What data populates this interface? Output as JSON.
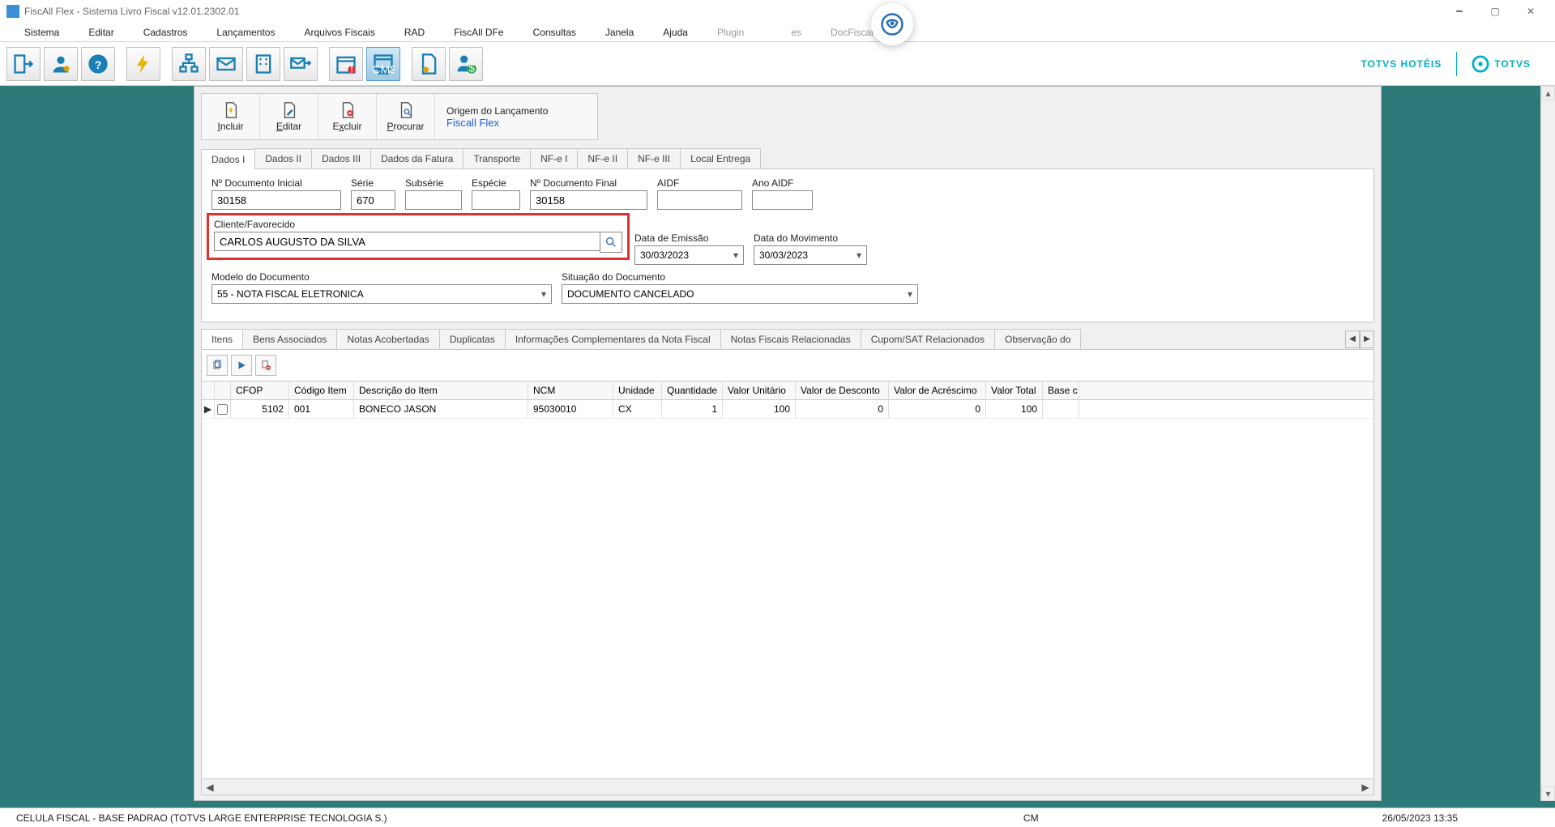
{
  "window": {
    "title": "FiscAll Flex - Sistema Livro Fiscal v12.01.2302.01"
  },
  "menubar": {
    "items": [
      "Sistema",
      "Editar",
      "Cadastros",
      "Lançamentos",
      "Arquivos Fiscais",
      "RAD",
      "FiscAll DFe",
      "Consultas",
      "Janela",
      "Ajuda"
    ],
    "disabled": [
      "Plugin",
      "",
      "es",
      "DocFiscall"
    ]
  },
  "brand": {
    "hoteis": "TOTVS HOTÉIS",
    "totvs": "TOTVS"
  },
  "actions": {
    "incluir": "Incluir",
    "editar": "Editar",
    "excluir": "Excluir",
    "procurar": "Procurar",
    "origin_label": "Origem do Lançamento",
    "origin_value": "Fiscall Flex"
  },
  "tabs_main": [
    "Dados I",
    "Dados II",
    "Dados III",
    "Dados da Fatura",
    "Transporte",
    "NF-e I",
    "NF-e II",
    "NF-e III",
    "Local Entrega"
  ],
  "form": {
    "ndoc_ini_label": "Nº Documento Inicial",
    "ndoc_ini": "30158",
    "serie_label": "Série",
    "serie": "670",
    "subserie_label": "Subsérie",
    "subserie": "",
    "especie_label": "Espécie",
    "especie": "",
    "ndoc_fin_label": "Nº Documento Final",
    "ndoc_fin": "30158",
    "aidf_label": "AIDF",
    "aidf": "",
    "ano_aidf_label": "Ano AIDF",
    "ano_aidf": "",
    "cliente_label": "Cliente/Favorecido",
    "cliente": "CARLOS AUGUSTO DA SILVA",
    "data_emissao_label": "Data de Emissão",
    "data_emissao": "30/03/2023",
    "data_mov_label": "Data do Movimento",
    "data_mov": "30/03/2023",
    "modelo_label": "Modelo do Documento",
    "modelo": "55 - NOTA FISCAL ELETRONICA",
    "situacao_label": "Situação do Documento",
    "situacao": "DOCUMENTO CANCELADO"
  },
  "tabs_items": [
    "Itens",
    "Bens Associados",
    "Notas Acobertadas",
    "Duplicatas",
    "Informações Complementares da Nota Fiscal",
    "Notas Fiscais Relacionadas",
    "Cupom/SAT Relacionados",
    "Observação do"
  ],
  "grid": {
    "headers": [
      "CFOP",
      "Código Item",
      "Descrição do Item",
      "NCM",
      "Unidade",
      "Quantidade",
      "Valor Unitário",
      "Valor de Desconto",
      "Valor de Acréscimo",
      "Valor Total",
      "Base c"
    ],
    "row": {
      "cfop": "5102",
      "codigo": "001",
      "desc": "BONECO JASON",
      "ncm": "95030010",
      "unidade": "CX",
      "qtd": "1",
      "vunit": "100",
      "vdesc": "0",
      "vacr": "0",
      "vtotal": "100",
      "base": ""
    }
  },
  "status": {
    "left": "CELULA FISCAL - BASE PADRAO (TOTVS LARGE ENTERPRISE TECNOLOGIA S.)",
    "cm": "CM",
    "datetime": "26/05/2023 13:35"
  }
}
